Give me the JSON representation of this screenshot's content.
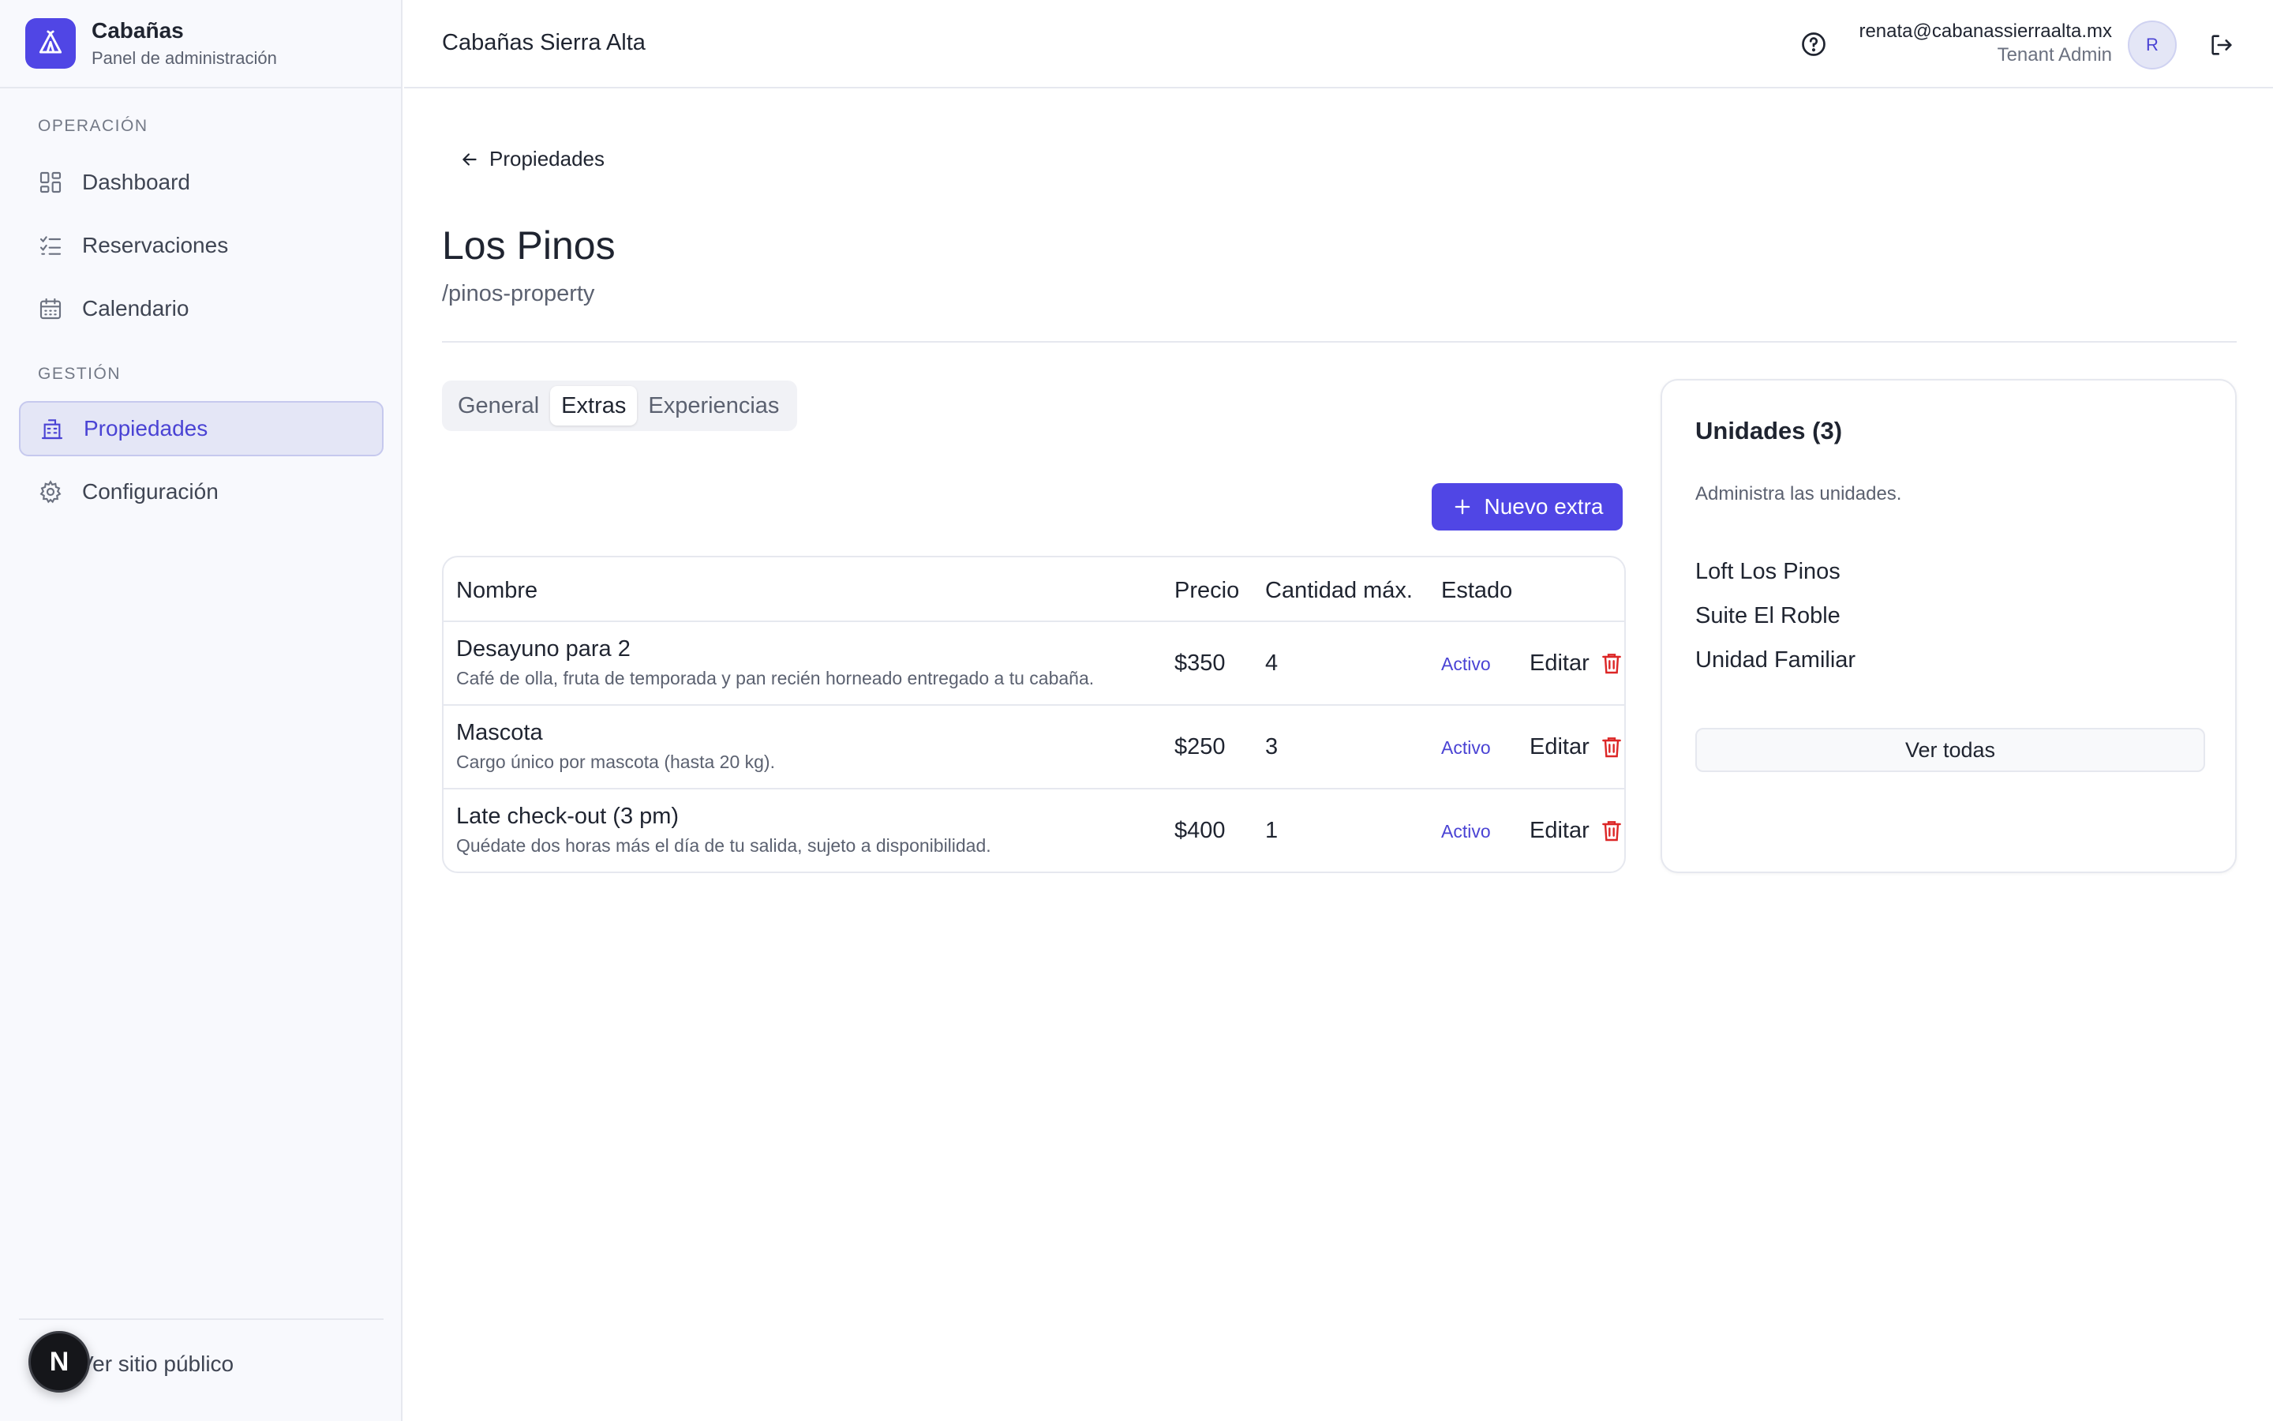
{
  "brand": {
    "name": "Cabañas",
    "subtitle": "Panel de administración"
  },
  "sidebar": {
    "sections": [
      {
        "label": "OPERACIÓN"
      },
      {
        "label": "GESTIÓN"
      }
    ],
    "items": [
      {
        "label": "Dashboard",
        "icon": "grid-icon"
      },
      {
        "label": "Reservaciones",
        "icon": "list-check-icon"
      },
      {
        "label": "Calendario",
        "icon": "calendar-icon"
      },
      {
        "label": "Propiedades",
        "icon": "building-icon",
        "active": true
      },
      {
        "label": "Configuración",
        "icon": "gear-icon"
      }
    ],
    "footer_link": "Ver sitio público",
    "badge_letter": "N"
  },
  "header": {
    "title": "Cabañas Sierra Alta",
    "user_email": "renata@cabanassierraalta.mx",
    "user_role": "Tenant Admin",
    "avatar_initial": "R"
  },
  "main": {
    "back_label": "Propiedades",
    "title": "Los Pinos",
    "slug": "/pinos-property",
    "tabs": [
      {
        "label": "General"
      },
      {
        "label": "Extras",
        "active": true
      },
      {
        "label": "Experiencias"
      }
    ],
    "new_button": "Nuevo extra",
    "table": {
      "columns": [
        "Nombre",
        "Precio",
        "Cantidad máx.",
        "Estado"
      ],
      "edit_label": "Editar",
      "rows": [
        {
          "name": "Desayuno para 2",
          "description": "Café de olla, fruta de temporada y pan recién horneado entregado a tu cabaña.",
          "price": "$350",
          "max_qty": "4",
          "status": "Activo"
        },
        {
          "name": "Mascota",
          "description": "Cargo único por mascota (hasta 20 kg).",
          "price": "$250",
          "max_qty": "3",
          "status": "Activo"
        },
        {
          "name": "Late check-out (3 pm)",
          "description": "Quédate dos horas más el día de tu salida, sujeto a disponibilidad.",
          "price": "$400",
          "max_qty": "1",
          "status": "Activo"
        }
      ]
    }
  },
  "units": {
    "title": "Unidades (3)",
    "subtitle": "Administra las unidades.",
    "items": [
      "Loft Los Pinos",
      "Suite El Roble",
      "Unidad Familiar"
    ],
    "view_all": "Ver todas"
  },
  "colors": {
    "accent": "#5046e5",
    "sidebar_bg": "#f8f9fd",
    "active_item_bg": "#e4e6f6",
    "danger": "#dc2626",
    "status_active": "#4a43d4"
  }
}
